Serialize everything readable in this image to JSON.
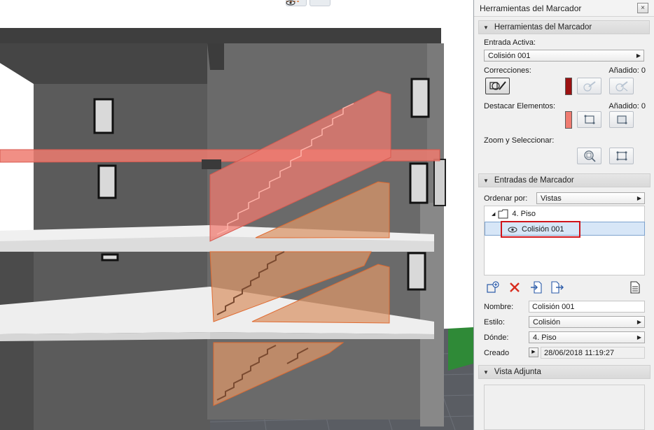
{
  "palette": {
    "window_title": "Herramientas del Marcador",
    "close_glyph": "×",
    "tools_section": {
      "title": "Herramientas del Marcador",
      "active_entry_label": "Entrada Activa:",
      "active_entry_value": "Colisión 001",
      "corrections_label": "Correcciones:",
      "corrections_added": "Añadido: 0",
      "corrections_color": "#9c1111",
      "highlight_label": "Destacar Elementos:",
      "highlight_added": "Añadido: 0",
      "highlight_color": "#ef7b70",
      "zoom_label": "Zoom y Seleccionar:"
    },
    "entries_section": {
      "title": "Entradas de Marcador",
      "sort_label": "Ordenar por:",
      "sort_value": "Vistas",
      "folder_label": "4. Piso",
      "selected_item": "Colisión 001"
    },
    "details": {
      "name_label": "Nombre:",
      "name_value": "Colisión 001",
      "style_label": "Estilo:",
      "style_value": "Colisión",
      "where_label": "Dónde:",
      "where_value": "4. Piso",
      "created_label": "Creado",
      "created_value": "28/06/2018 11:19:27"
    },
    "attached_view_section": {
      "title": "Vista Adjunta"
    }
  },
  "colors": {
    "accent_selection": "#d7e6f7",
    "highlight_outline": "#d0141b",
    "collision_fill": "#ef7b70",
    "stair_fill": "#d9956a"
  },
  "icons": [
    "eye-icon",
    "folder-icon",
    "add-entry-icon",
    "delete-icon",
    "import-icon",
    "export-icon",
    "document-icon",
    "play-icon",
    "zoom-icon",
    "select-icon",
    "pen-add-icon",
    "pen-remove-icon"
  ]
}
